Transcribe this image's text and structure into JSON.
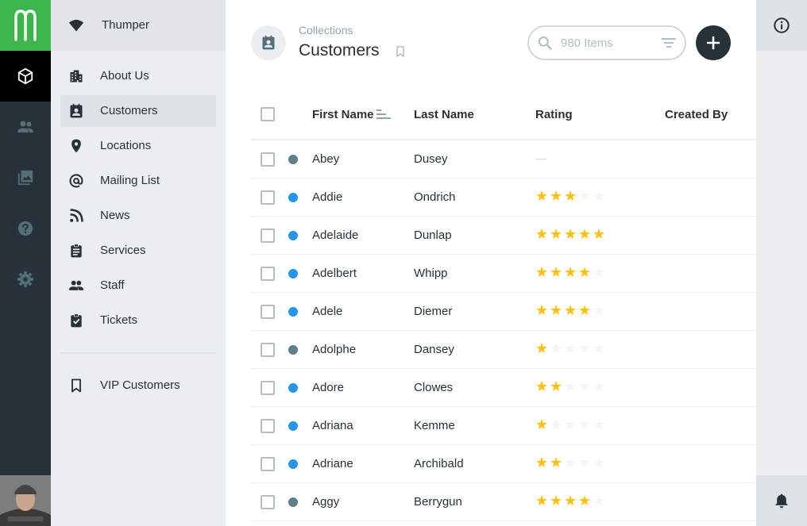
{
  "app": {
    "project_name": "Thumper"
  },
  "rail": {
    "items": [
      {
        "icon": "cube-icon",
        "active": true
      },
      {
        "icon": "users-icon"
      },
      {
        "icon": "image-library-icon"
      },
      {
        "icon": "help-icon"
      },
      {
        "icon": "settings-icon"
      }
    ]
  },
  "nav": {
    "items": [
      {
        "label": "About Us",
        "icon": "building-icon"
      },
      {
        "label": "Customers",
        "icon": "contact-card-icon",
        "active": true
      },
      {
        "label": "Locations",
        "icon": "map-pin-icon"
      },
      {
        "label": "Mailing List",
        "icon": "at-sign-icon"
      },
      {
        "label": "News",
        "icon": "rss-icon"
      },
      {
        "label": "Services",
        "icon": "clipboard-icon"
      },
      {
        "label": "Staff",
        "icon": "people-icon"
      },
      {
        "label": "Tickets",
        "icon": "checklist-icon"
      }
    ],
    "bookmarks": [
      {
        "label": "VIP Customers",
        "icon": "bookmark-icon"
      }
    ]
  },
  "header": {
    "breadcrumb": "Collections",
    "title": "Customers",
    "search_placeholder": "980 Items"
  },
  "table": {
    "columns": [
      "First Name",
      "Last Name",
      "Rating",
      "Created By"
    ],
    "rows": [
      {
        "status": "draft",
        "first": "Abey",
        "last": "Dusey",
        "rating": null
      },
      {
        "status": "published",
        "first": "Addie",
        "last": "Ondrich",
        "rating": 3
      },
      {
        "status": "published",
        "first": "Adelaide",
        "last": "Dunlap",
        "rating": 5
      },
      {
        "status": "published",
        "first": "Adelbert",
        "last": "Whipp",
        "rating": 4
      },
      {
        "status": "published",
        "first": "Adele",
        "last": "Diemer",
        "rating": 4
      },
      {
        "status": "draft",
        "first": "Adolphe",
        "last": "Dansey",
        "rating": 1
      },
      {
        "status": "published",
        "first": "Adore",
        "last": "Clowes",
        "rating": 2
      },
      {
        "status": "published",
        "first": "Adriana",
        "last": "Kemme",
        "rating": 1
      },
      {
        "status": "published",
        "first": "Adriane",
        "last": "Archibald",
        "rating": 2
      },
      {
        "status": "draft",
        "first": "Aggy",
        "last": "Berrygun",
        "rating": 4
      }
    ],
    "empty_rating": "—"
  },
  "colors": {
    "brand_green": "#3cb54a",
    "published": "#2196f3",
    "draft": "#607d8b",
    "star_on": "#ffc107",
    "star_off": "#f3f5f6",
    "dark": "#263238"
  }
}
